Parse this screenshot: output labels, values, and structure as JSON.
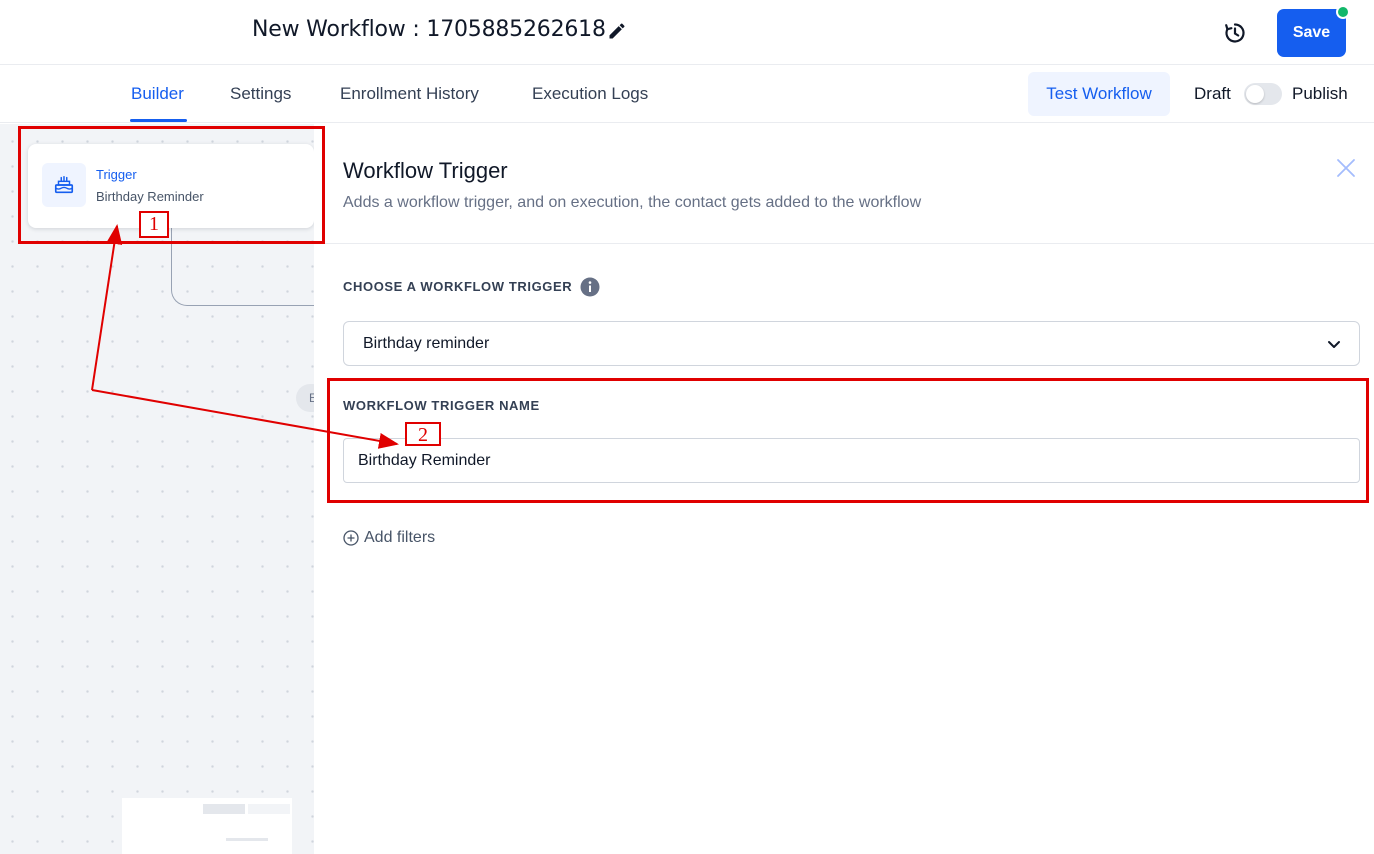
{
  "header": {
    "title": "New Workflow : 1705885262618",
    "save_label": "Save",
    "save_color": "#155eef",
    "status_dot_color": "#12b76a",
    "edit_icon": "pencil-icon",
    "history_icon": "history-icon"
  },
  "tabs": [
    {
      "label": "Builder",
      "active": true
    },
    {
      "label": "Settings",
      "active": false
    },
    {
      "label": "Enrollment History",
      "active": false
    },
    {
      "label": "Execution Logs",
      "active": false
    }
  ],
  "toolbar": {
    "test_workflow_label": "Test Workflow",
    "draft_label": "Draft",
    "publish_label": "Publish",
    "published": false
  },
  "canvas": {
    "trigger_node": {
      "icon": "cake-icon",
      "type_label": "Trigger",
      "name": "Birthday Reminder"
    },
    "collapsed_pill_text": "E"
  },
  "panel": {
    "title": "Workflow Trigger",
    "subtitle": "Adds a workflow trigger, and on execution, the contact gets added to the workflow",
    "choose_label": "CHOOSE A WORKFLOW TRIGGER",
    "selected_trigger": "Birthday reminder",
    "name_label": "WORKFLOW TRIGGER NAME",
    "trigger_name_value": "Birthday Reminder",
    "add_filters_label": "Add filters"
  },
  "annotations": {
    "marker_1": "1",
    "marker_2": "2",
    "color": "#e00000"
  }
}
